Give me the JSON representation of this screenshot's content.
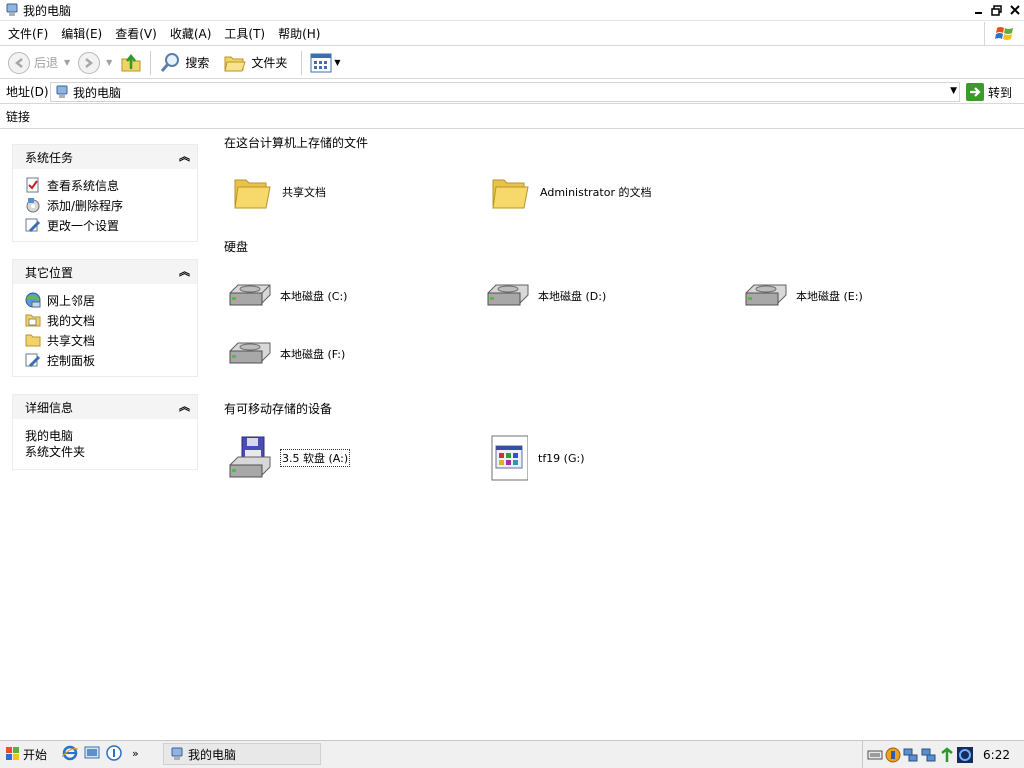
{
  "window": {
    "title": "我的电脑"
  },
  "menu": [
    "文件(F)",
    "编辑(E)",
    "查看(V)",
    "收藏(A)",
    "工具(T)",
    "帮助(H)"
  ],
  "toolbar": {
    "back": "后退",
    "search": "搜索",
    "folders": "文件夹"
  },
  "address": {
    "label": "地址(D)",
    "value": "我的电脑",
    "go": "转到"
  },
  "links": {
    "label": "链接"
  },
  "left": {
    "system_tasks": {
      "title": "系统任务",
      "items": [
        "查看系统信息",
        "添加/删除程序",
        "更改一个设置"
      ]
    },
    "other_places": {
      "title": "其它位置",
      "items": [
        "网上邻居",
        "我的文档",
        "共享文档",
        "控制面板"
      ]
    },
    "details": {
      "title": "详细信息",
      "name": "我的电脑",
      "type": "系统文件夹"
    }
  },
  "content": {
    "stored_files": {
      "title": "在这台计算机上存储的文件",
      "items": [
        "共享文档",
        "Administrator 的文档"
      ]
    },
    "hard_disks": {
      "title": "硬盘",
      "items": [
        "本地磁盘 (C:)",
        "本地磁盘 (D:)",
        "本地磁盘 (E:)",
        "本地磁盘 (F:)"
      ]
    },
    "removable": {
      "title": "有可移动存储的设备",
      "items": [
        "3.5 软盘 (A:)",
        "tf19 (G:)"
      ]
    }
  },
  "taskbar": {
    "start": "开始",
    "window_button": "我的电脑",
    "clock": "6:22"
  },
  "colors": {
    "folder": "#f7d86b",
    "accent_green": "#3a9a2a",
    "selection_border": "#333333"
  }
}
